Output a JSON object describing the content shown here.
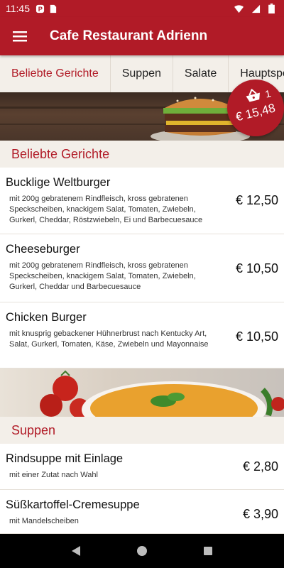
{
  "status_bar": {
    "time": "11:45",
    "icons": [
      "notification-icon",
      "sim-card-icon",
      "wifi-icon",
      "signal-icon",
      "battery-icon"
    ]
  },
  "app_bar": {
    "title": "Cafe Restaurant Adrienn",
    "menu_icon": "hamburger-menu-icon"
  },
  "tabs": [
    {
      "label": "Beliebte Gerichte",
      "active": true
    },
    {
      "label": "Suppen",
      "active": false
    },
    {
      "label": "Salate",
      "active": false
    },
    {
      "label": "Hauptspeisen",
      "active": false
    }
  ],
  "cart": {
    "count": "1",
    "total": "€ 15,48",
    "icon": "shopping-basket-icon"
  },
  "sections": [
    {
      "title": "Beliebte Gerichte",
      "items": [
        {
          "name": "Bucklige Weltburger",
          "description": "mit 200g gebratenem Rindfleisch, kross gebratenen Speckscheiben, knackigem Salat, Tomaten, Zwiebeln, Gurkerl, Cheddar, Röstzwiebeln, Ei und Barbecuesauce",
          "price": "€ 12,50"
        },
        {
          "name": "Cheeseburger",
          "description": "mit 200g gebratenem Rindfleisch, kross gebratenen Speckscheiben, knackigem Salat, Tomaten, Zwiebeln, Gurkerl, Cheddar und Barbecuesauce",
          "price": "€ 10,50"
        },
        {
          "name": "Chicken Burger",
          "description": "mit knusprig gebackener Hühnerbrust nach Kentucky Art, Salat, Gurkerl, Tomaten, Käse, Zwiebeln und Mayonnaise",
          "price": "€ 10,50"
        }
      ]
    },
    {
      "title": "Suppen",
      "items": [
        {
          "name": "Rindsuppe mit Einlage",
          "description": "mit einer Zutat nach Wahl",
          "price": "€ 2,80"
        },
        {
          "name": "Süßkartoffel-Cremesuppe",
          "description": "mit Mandelscheiben",
          "price": "€ 3,90"
        }
      ]
    }
  ],
  "colors": {
    "brand": "#b11b27",
    "background": "#f3efe9",
    "card": "#ffffff"
  },
  "nav_bar": {
    "icons": [
      "back-icon",
      "home-icon",
      "recents-icon"
    ]
  }
}
